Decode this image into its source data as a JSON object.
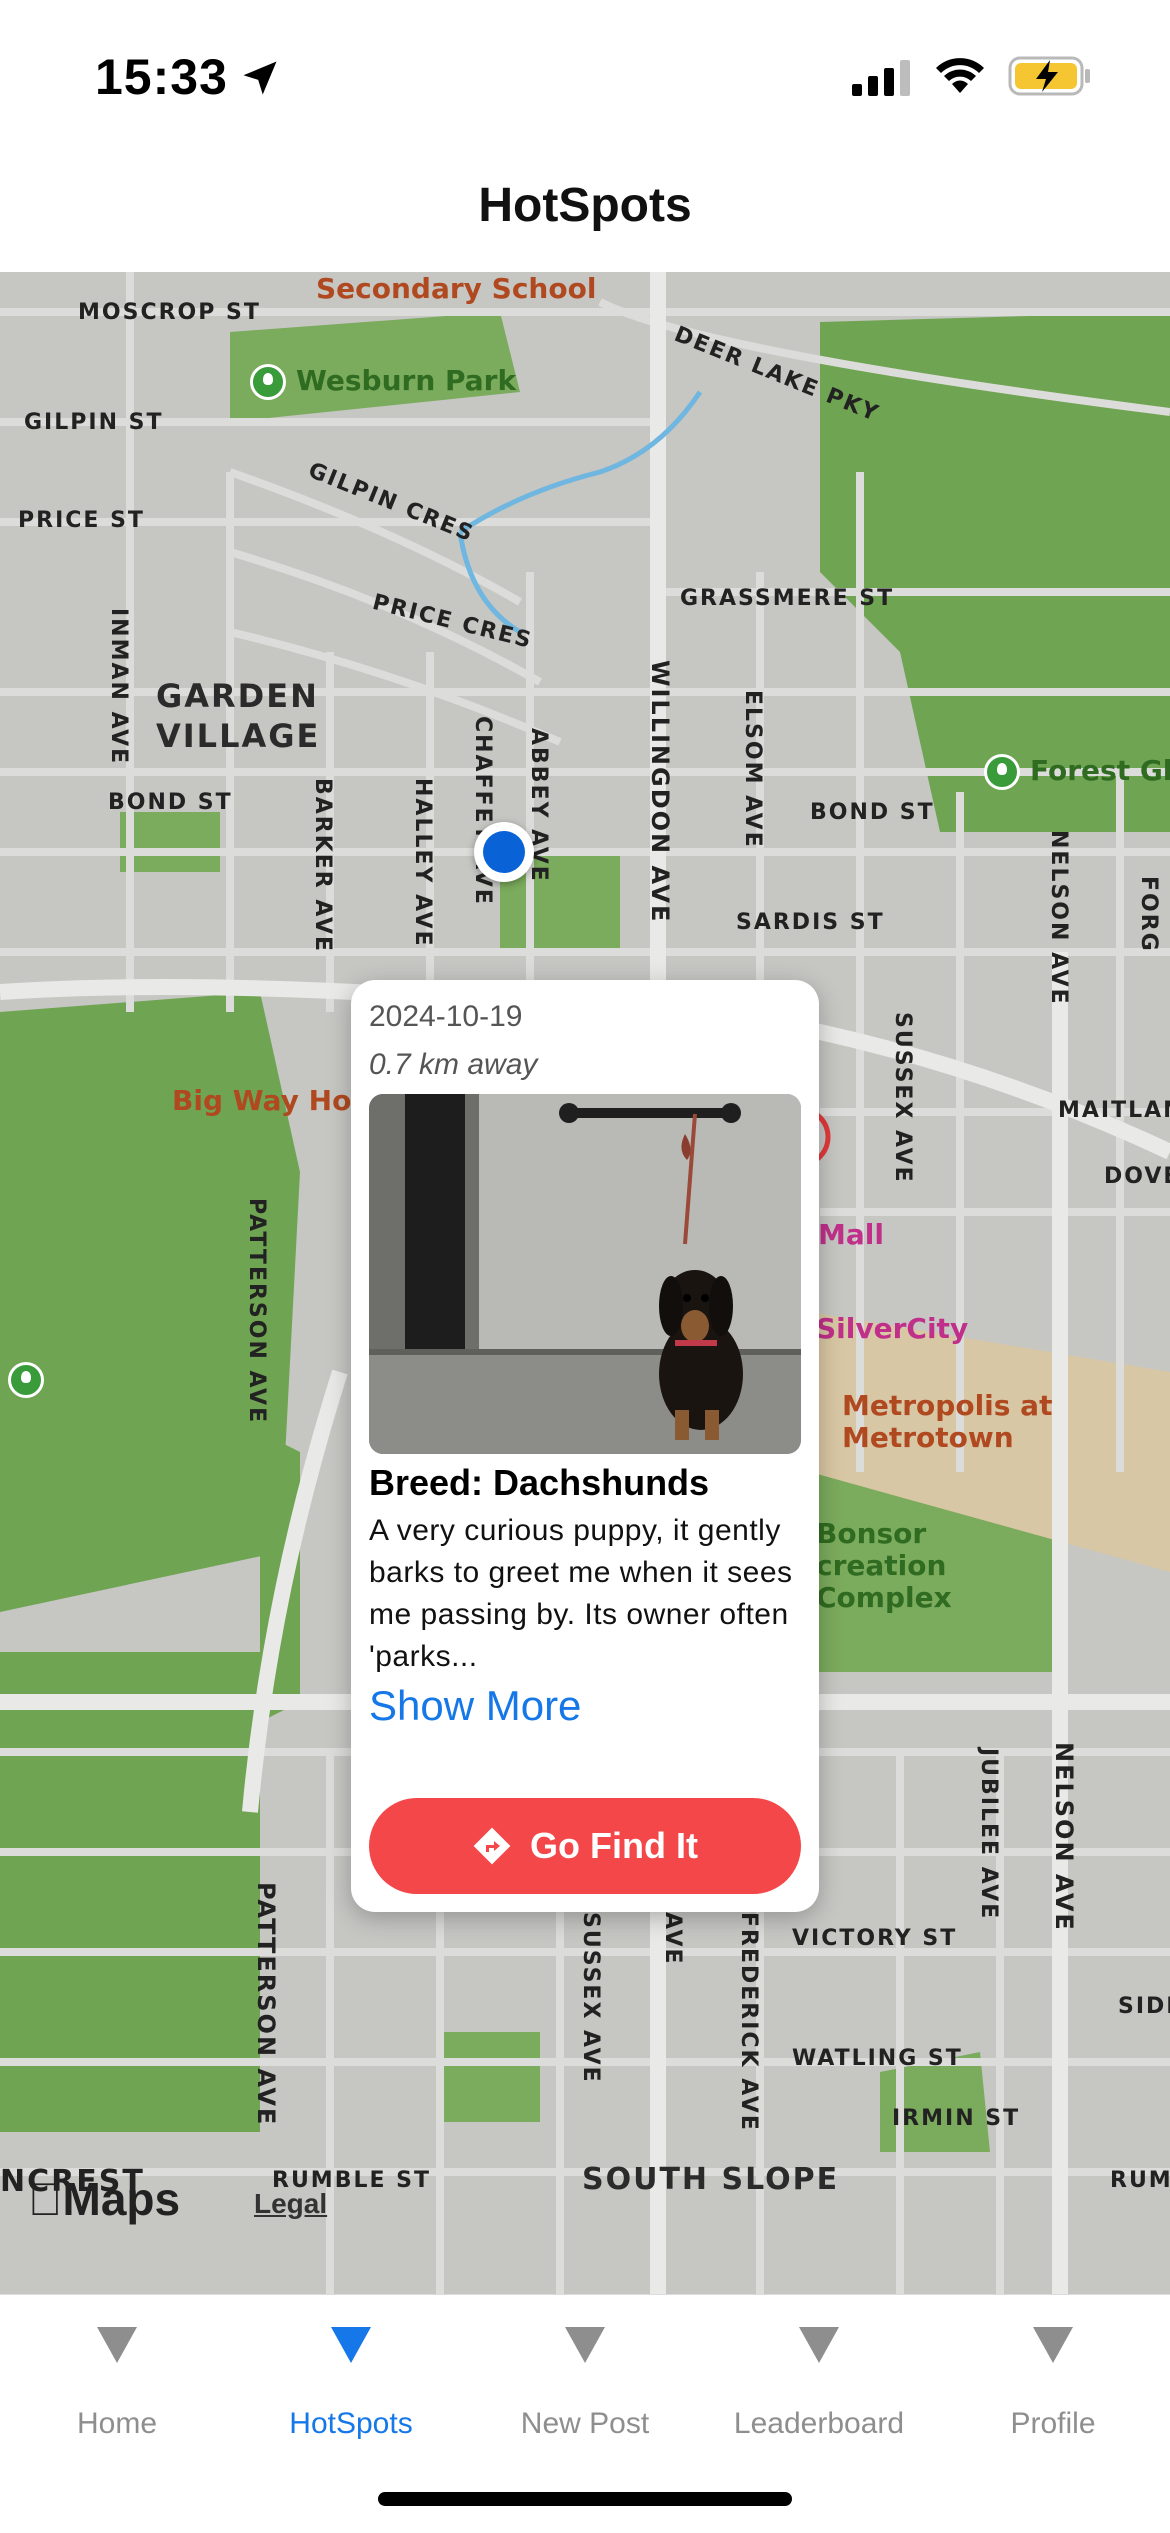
{
  "status_bar": {
    "time": "15:33",
    "icons": [
      "location-arrow-icon",
      "cellular-signal-icon",
      "wifi-icon",
      "battery-charging-icon"
    ],
    "battery_color": "#f6c532"
  },
  "header": {
    "title": "HotSpots"
  },
  "map": {
    "streets": {
      "moscrop": "MOSCROP ST",
      "gilpin_st": "GILPIN ST",
      "price_st": "PRICE ST",
      "gilpin_cres": "GILPIN CRES",
      "price_cres": "PRICE CRES",
      "deer_lake": "DEER LAKE PKY",
      "grassmere": "GRASSMERE ST",
      "bond_w": "BOND ST",
      "bond_e": "BOND ST",
      "sardis": "SARDIS ST",
      "maitland": "MAITLAN",
      "dover": "DOVE",
      "inman": "INMAN AVE",
      "barker": "BARKER AVE",
      "halley": "HALLEY AVE",
      "chaffey": "CHAFFEY AVE",
      "abbey": "ABBEY AVE",
      "willingdon": "WILLINGDON AVE",
      "elsom": "ELSOM AVE",
      "nelson_n": "NELSON AVE",
      "forglen": "FORG",
      "sussex_n": "SUSSEX AVE",
      "patterson_n": "PATTERSON AVE",
      "patterson_s": "PATTERSON AVE",
      "jubilee": "JUBILEE AVE",
      "nelson_s": "NELSON AVE",
      "sidley": "SIDL",
      "victory": "VICTORY ST",
      "watling": "WATLING ST",
      "irmin": "IRMIN ST",
      "sussex_s": "SUSSEX AVE",
      "frederick": "FREDERICK AVE",
      "ave_frag": "AVE",
      "rumble_w": "RUMBLE ST",
      "rumble_e": "RUM",
      "crest": "NCREST"
    },
    "places": {
      "garden_village": "GARDEN VILLAGE",
      "south_slope": "SOUTH SLOPE"
    },
    "pois": {
      "secondary_school": "Secondary School",
      "wesburn_park": "Wesburn Park",
      "forest_glen": "Forest Gle",
      "big_way": "Big Way Hot",
      "mall": "Mall",
      "silvercity": "SilverCity",
      "metropolis": "Metropolis at Metrotown",
      "bonsor": "Bonsor creation Complex"
    },
    "brand": "Maps",
    "legal": "Legal",
    "colors": {
      "park": "#6fa452",
      "road": "#d8d8d6",
      "user_dot": "#0a63d6"
    }
  },
  "popup": {
    "date": "2024-10-19",
    "distance": "0.7 km away",
    "breed": "Breed: Dachshunds",
    "description": "A very curious puppy, it gently barks to greet me when it sees me passing by. Its owner often 'parks...",
    "show_more": "Show More",
    "cta_label": "Go Find It",
    "cta_color": "#f4474a",
    "image_subject": "dachshund tied to a wall-mounted bar"
  },
  "tab_bar": {
    "active_color": "#1677e8",
    "tabs": [
      {
        "label": "Home",
        "active": false
      },
      {
        "label": "HotSpots",
        "active": true
      },
      {
        "label": "New Post",
        "active": false
      },
      {
        "label": "Leaderboard",
        "active": false
      },
      {
        "label": "Profile",
        "active": false
      }
    ]
  }
}
